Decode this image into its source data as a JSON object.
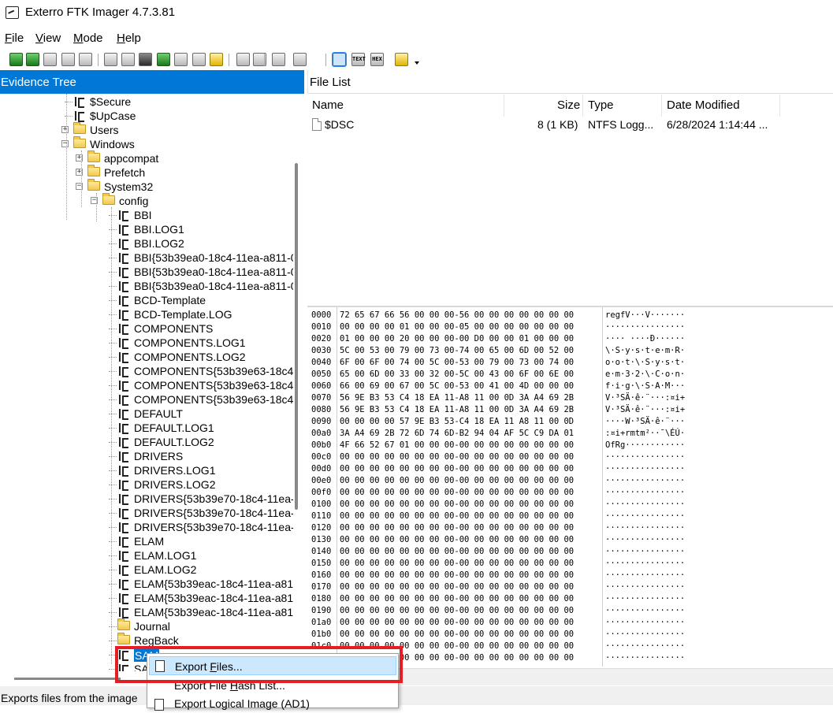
{
  "window": {
    "title": "Exterro FTK Imager 4.7.3.81"
  },
  "menu": [
    "File",
    "View",
    "Mode",
    "Help"
  ],
  "toolbar": {
    "buttons": [
      "add-evidence-icon",
      "add-all-evidence-icon",
      "create-image-icon",
      "remove-evidence-icon",
      "remove-all-evidence-icon",
      "create-disk-image-icon",
      "export-image-icon",
      "export-logical-image-icon",
      "capture-memory-icon",
      "obtain-protected-files-icon",
      "detect-encryption-icon",
      "export-files-icon",
      "export-hash-list-icon",
      "verify-drive-icon",
      "image-mounting-icon",
      "export-directory-listing-icon",
      "auto-view-icon",
      "text-view-icon",
      "hex-view-icon",
      "help-icon"
    ]
  },
  "evidence_tree": {
    "header": "Evidence Tree",
    "items": [
      {
        "label": "$Secure",
        "type": "file"
      },
      {
        "label": "$UpCase",
        "type": "file"
      },
      {
        "label": "Users",
        "type": "folder"
      },
      {
        "label": "Windows",
        "type": "folder"
      },
      {
        "label": "appcompat",
        "type": "folder"
      },
      {
        "label": "Prefetch",
        "type": "folder"
      },
      {
        "label": "System32",
        "type": "folder"
      },
      {
        "label": "config",
        "type": "folder"
      },
      {
        "label": "BBI",
        "type": "file"
      },
      {
        "label": "BBI.LOG1",
        "type": "file"
      },
      {
        "label": "BBI.LOG2",
        "type": "file"
      },
      {
        "label": "BBI{53b39ea0-18c4-11ea-a811-0",
        "type": "file"
      },
      {
        "label": "BBI{53b39ea0-18c4-11ea-a811-0",
        "type": "file"
      },
      {
        "label": "BBI{53b39ea0-18c4-11ea-a811-0",
        "type": "file"
      },
      {
        "label": "BCD-Template",
        "type": "file"
      },
      {
        "label": "BCD-Template.LOG",
        "type": "file"
      },
      {
        "label": "COMPONENTS",
        "type": "file"
      },
      {
        "label": "COMPONENTS.LOG1",
        "type": "file"
      },
      {
        "label": "COMPONENTS.LOG2",
        "type": "file"
      },
      {
        "label": "COMPONENTS{53b39e63-18c4-",
        "type": "file"
      },
      {
        "label": "COMPONENTS{53b39e63-18c4-",
        "type": "file"
      },
      {
        "label": "COMPONENTS{53b39e63-18c4-",
        "type": "file"
      },
      {
        "label": "DEFAULT",
        "type": "file"
      },
      {
        "label": "DEFAULT.LOG1",
        "type": "file"
      },
      {
        "label": "DEFAULT.LOG2",
        "type": "file"
      },
      {
        "label": "DRIVERS",
        "type": "file"
      },
      {
        "label": "DRIVERS.LOG1",
        "type": "file"
      },
      {
        "label": "DRIVERS.LOG2",
        "type": "file"
      },
      {
        "label": "DRIVERS{53b39e70-18c4-11ea-",
        "type": "file"
      },
      {
        "label": "DRIVERS{53b39e70-18c4-11ea-",
        "type": "file"
      },
      {
        "label": "DRIVERS{53b39e70-18c4-11ea-",
        "type": "file"
      },
      {
        "label": "ELAM",
        "type": "file"
      },
      {
        "label": "ELAM.LOG1",
        "type": "file"
      },
      {
        "label": "ELAM.LOG2",
        "type": "file"
      },
      {
        "label": "ELAM{53b39eac-18c4-11ea-a81",
        "type": "file"
      },
      {
        "label": "ELAM{53b39eac-18c4-11ea-a81",
        "type": "file"
      },
      {
        "label": "ELAM{53b39eac-18c4-11ea-a81",
        "type": "file"
      },
      {
        "label": "Journal",
        "type": "folder"
      },
      {
        "label": "RegBack",
        "type": "folder"
      },
      {
        "label": "SAM",
        "type": "file",
        "selected": true
      },
      {
        "label": "SA",
        "type": "file"
      }
    ]
  },
  "file_list": {
    "header": "File List",
    "columns": [
      "Name",
      "Size",
      "Type",
      "Date Modified"
    ],
    "rows": [
      {
        "name": "$DSC",
        "size": "8 (1 KB)",
        "type": "NTFS Logg...",
        "date": "6/28/2024 1:14:44 ..."
      }
    ]
  },
  "hex_view": {
    "rows": [
      {
        "off": "0000",
        "hex": "72 65 67 66 56 00 00 00-56 00 00 00 00 00 00 00",
        "txt": "regfV···V·······"
      },
      {
        "off": "0010",
        "hex": "00 00 00 00 01 00 00 00-05 00 00 00 00 00 00 00",
        "txt": "················"
      },
      {
        "off": "0020",
        "hex": "01 00 00 00 20 00 00 00-00 D0 00 00 01 00 00 00",
        "txt": "···· ····Ð······"
      },
      {
        "off": "0030",
        "hex": "5C 00 53 00 79 00 73 00-74 00 65 00 6D 00 52 00",
        "txt": "\\·S·y·s·t·e·m·R·"
      },
      {
        "off": "0040",
        "hex": "6F 00 6F 00 74 00 5C 00-53 00 79 00 73 00 74 00",
        "txt": "o·o·t·\\·S·y·s·t·"
      },
      {
        "off": "0050",
        "hex": "65 00 6D 00 33 00 32 00-5C 00 43 00 6F 00 6E 00",
        "txt": "e·m·3·2·\\·C·o·n·"
      },
      {
        "off": "0060",
        "hex": "66 00 69 00 67 00 5C 00-53 00 41 00 4D 00 00 00",
        "txt": "f·i·g·\\·S·A·M···"
      },
      {
        "off": "0070",
        "hex": "56 9E B3 53 C4 18 EA 11-A8 11 00 0D 3A A4 69 2B",
        "txt": "V·³SÄ·ê·¨···:¤i+"
      },
      {
        "off": "0080",
        "hex": "56 9E B3 53 C4 18 EA 11-A8 11 00 0D 3A A4 69 2B",
        "txt": "V·³SÄ·ê·¨···:¤i+"
      },
      {
        "off": "0090",
        "hex": "00 00 00 00 57 9E B3 53-C4 18 EA 11 A8 11 00 0D",
        "txt": "····W·³SÄ·ê·¨···"
      },
      {
        "off": "00a0",
        "hex": "3A A4 69 2B 72 6D 74 6D-B2 94 04 AF 5C C9 DA 01",
        "txt": ":¤i+rmtm²··¯\\ÉÚ·"
      },
      {
        "off": "00b0",
        "hex": "4F 66 52 67 01 00 00 00-00 00 00 00 00 00 00 00",
        "txt": "OfRg············"
      },
      {
        "off": "00c0",
        "hex": "00 00 00 00 00 00 00 00-00 00 00 00 00 00 00 00",
        "txt": "················"
      },
      {
        "off": "00d0",
        "hex": "00 00 00 00 00 00 00 00-00 00 00 00 00 00 00 00",
        "txt": "················"
      },
      {
        "off": "00e0",
        "hex": "00 00 00 00 00 00 00 00-00 00 00 00 00 00 00 00",
        "txt": "················"
      },
      {
        "off": "00f0",
        "hex": "00 00 00 00 00 00 00 00-00 00 00 00 00 00 00 00",
        "txt": "················"
      },
      {
        "off": "0100",
        "hex": "00 00 00 00 00 00 00 00-00 00 00 00 00 00 00 00",
        "txt": "················"
      },
      {
        "off": "0110",
        "hex": "00 00 00 00 00 00 00 00-00 00 00 00 00 00 00 00",
        "txt": "················"
      },
      {
        "off": "0120",
        "hex": "00 00 00 00 00 00 00 00-00 00 00 00 00 00 00 00",
        "txt": "················"
      },
      {
        "off": "0130",
        "hex": "00 00 00 00 00 00 00 00-00 00 00 00 00 00 00 00",
        "txt": "················"
      },
      {
        "off": "0140",
        "hex": "00 00 00 00 00 00 00 00-00 00 00 00 00 00 00 00",
        "txt": "················"
      },
      {
        "off": "0150",
        "hex": "00 00 00 00 00 00 00 00-00 00 00 00 00 00 00 00",
        "txt": "················"
      },
      {
        "off": "0160",
        "hex": "00 00 00 00 00 00 00 00-00 00 00 00 00 00 00 00",
        "txt": "················"
      },
      {
        "off": "0170",
        "hex": "00 00 00 00 00 00 00 00-00 00 00 00 00 00 00 00",
        "txt": "················"
      },
      {
        "off": "0180",
        "hex": "00 00 00 00 00 00 00 00-00 00 00 00 00 00 00 00",
        "txt": "················"
      },
      {
        "off": "0190",
        "hex": "00 00 00 00 00 00 00 00-00 00 00 00 00 00 00 00",
        "txt": "················"
      },
      {
        "off": "01a0",
        "hex": "00 00 00 00 00 00 00 00-00 00 00 00 00 00 00 00",
        "txt": "················"
      },
      {
        "off": "01b0",
        "hex": "00 00 00 00 00 00 00 00-00 00 00 00 00 00 00 00",
        "txt": "················"
      },
      {
        "off": "01c0",
        "hex": "00 00 00 00 00 00 00 00-00 00 00 00 00 00 00 00",
        "txt": "················"
      },
      {
        "off": "01d0",
        "hex": "00 00 00 00 00 00 00 00-00 00 00 00 00 00 00 00",
        "txt": "················"
      }
    ]
  },
  "context_menu": {
    "items": [
      {
        "label_pre": "Export ",
        "label_ul": "F",
        "label_post": "iles...",
        "highlighted": true
      },
      {
        "label_pre": "Export File ",
        "label_ul": "H",
        "label_post": "ash List..."
      },
      {
        "label_pre": "Export Logical Image (AD1)",
        "label_ul": "",
        "label_post": ""
      }
    ]
  },
  "status_bar": {
    "text": "Exports files from the image"
  },
  "colors": {
    "accent": "#0078d7",
    "highlight_box": "#e31e24",
    "menu_highlight": "#cce8ff"
  }
}
